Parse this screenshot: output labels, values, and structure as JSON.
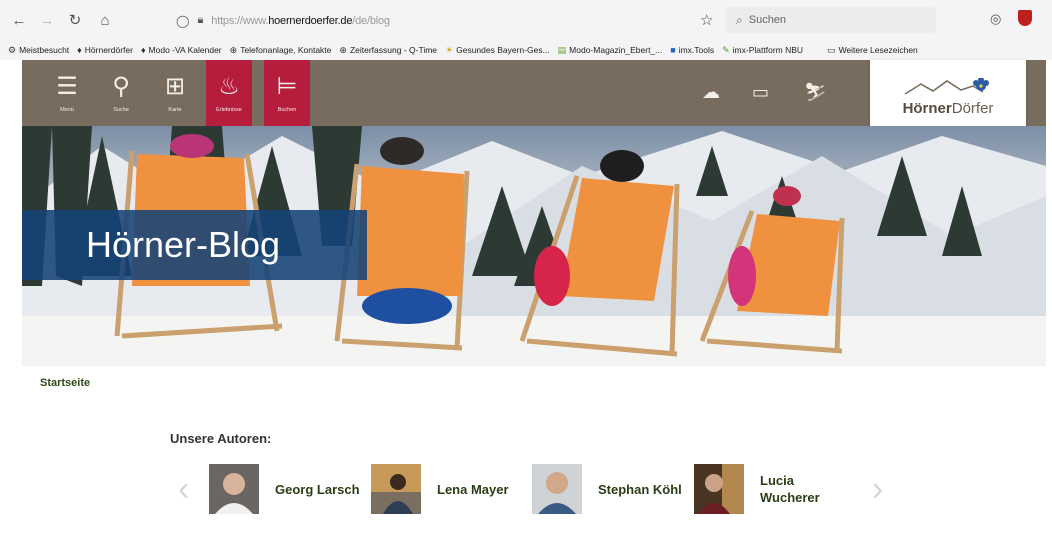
{
  "browser": {
    "url_prefix": "https://www.",
    "url_domain": "hoernerdoerfer.de",
    "url_path": "/de/blog",
    "search_placeholder": "Suchen",
    "bookmarks": [
      {
        "label": "Meistbesucht",
        "icon": "gear-icon"
      },
      {
        "label": "Hörnerdörfer",
        "icon": "pin-icon"
      },
      {
        "label": "Modo -VA Kalender",
        "icon": "pin-icon"
      },
      {
        "label": "Telefonanlage, Kontakte",
        "icon": "globe-icon"
      },
      {
        "label": "Zeiterfassung - Q-Time",
        "icon": "globe-icon"
      },
      {
        "label": "Gesundes Bayern-Ges...",
        "icon": "sun-icon"
      },
      {
        "label": "Modo-Magazin_Ebert_...",
        "icon": "document-icon"
      },
      {
        "label": "imx.Tools",
        "icon": "square-icon"
      },
      {
        "label": "imx-Plattform NBU",
        "icon": "pen-icon"
      },
      {
        "label": "Weitere Lesezeichen",
        "icon": "folder-icon"
      }
    ]
  },
  "header": {
    "nav": [
      {
        "label": "Menü",
        "icon": "hamburger-icon"
      },
      {
        "label": "Suche",
        "icon": "search-icon"
      },
      {
        "label": "Karte",
        "icon": "map-icon"
      },
      {
        "label": "Erlebnisse",
        "icon": "campfire-icon"
      },
      {
        "label": "Buchen",
        "icon": "bed-icon"
      }
    ],
    "logo": {
      "part1": "Hörner",
      "part2": "Dörfer"
    }
  },
  "hero": {
    "title": "Hörner-Blog"
  },
  "breadcrumb": "Startseite",
  "authors": {
    "title": "Unsere Autoren:",
    "items": [
      {
        "name": "Georg Larsch"
      },
      {
        "name": "Lena Mayer"
      },
      {
        "name": "Stephan Köhl"
      },
      {
        "name": "Lucia Wucherer"
      }
    ]
  },
  "colors": {
    "header": "#776c5e",
    "active": "#b61d3c",
    "banner": "#144278",
    "deckchair": "#f0913f"
  }
}
